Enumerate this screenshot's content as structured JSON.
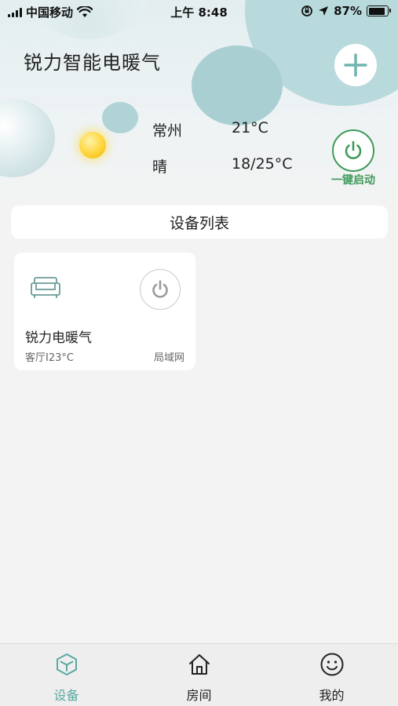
{
  "status_bar": {
    "carrier": "中国移动",
    "time": "上午 8:48",
    "battery": "87%",
    "battery_level": 0.87
  },
  "header": {
    "title": "锐力智能电暖气",
    "add_icon": "plus-icon"
  },
  "weather": {
    "icon": "sun-icon",
    "city": "常州",
    "current_temp": "21°C",
    "condition": "晴",
    "range": "18/25°C"
  },
  "power_all": {
    "icon": "power-icon",
    "label": "一键启动",
    "color": "#3f9a5b"
  },
  "device_list": {
    "title": "设备列表",
    "devices": [
      {
        "icon": "sofa-icon",
        "name": "锐力电暖气",
        "room_temp": "客厅I23°C",
        "network": "局域网",
        "power_icon": "power-icon"
      }
    ]
  },
  "tabs": [
    {
      "label": "设备",
      "icon": "cube-icon",
      "active": true
    },
    {
      "label": "房间",
      "icon": "house-icon",
      "active": false
    },
    {
      "label": "我的",
      "icon": "smiley-icon",
      "active": false
    }
  ],
  "colors": {
    "accent": "#5aa9a0",
    "power_green": "#3f9a5b",
    "background": "#f3f3f3"
  }
}
